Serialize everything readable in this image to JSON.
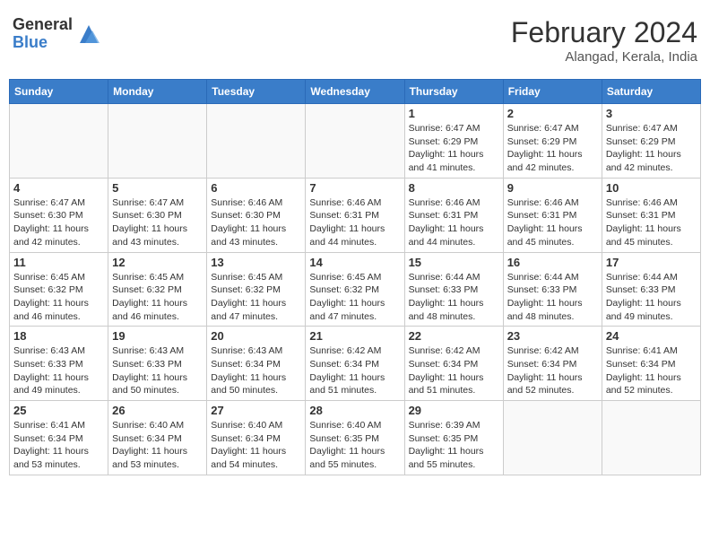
{
  "header": {
    "logo_general": "General",
    "logo_blue": "Blue",
    "month_year": "February 2024",
    "location": "Alangad, Kerala, India"
  },
  "days_of_week": [
    "Sunday",
    "Monday",
    "Tuesday",
    "Wednesday",
    "Thursday",
    "Friday",
    "Saturday"
  ],
  "weeks": [
    [
      {
        "day": "",
        "info": ""
      },
      {
        "day": "",
        "info": ""
      },
      {
        "day": "",
        "info": ""
      },
      {
        "day": "",
        "info": ""
      },
      {
        "day": "1",
        "info": "Sunrise: 6:47 AM\nSunset: 6:29 PM\nDaylight: 11 hours and 41 minutes."
      },
      {
        "day": "2",
        "info": "Sunrise: 6:47 AM\nSunset: 6:29 PM\nDaylight: 11 hours and 42 minutes."
      },
      {
        "day": "3",
        "info": "Sunrise: 6:47 AM\nSunset: 6:29 PM\nDaylight: 11 hours and 42 minutes."
      }
    ],
    [
      {
        "day": "4",
        "info": "Sunrise: 6:47 AM\nSunset: 6:30 PM\nDaylight: 11 hours and 42 minutes."
      },
      {
        "day": "5",
        "info": "Sunrise: 6:47 AM\nSunset: 6:30 PM\nDaylight: 11 hours and 43 minutes."
      },
      {
        "day": "6",
        "info": "Sunrise: 6:46 AM\nSunset: 6:30 PM\nDaylight: 11 hours and 43 minutes."
      },
      {
        "day": "7",
        "info": "Sunrise: 6:46 AM\nSunset: 6:31 PM\nDaylight: 11 hours and 44 minutes."
      },
      {
        "day": "8",
        "info": "Sunrise: 6:46 AM\nSunset: 6:31 PM\nDaylight: 11 hours and 44 minutes."
      },
      {
        "day": "9",
        "info": "Sunrise: 6:46 AM\nSunset: 6:31 PM\nDaylight: 11 hours and 45 minutes."
      },
      {
        "day": "10",
        "info": "Sunrise: 6:46 AM\nSunset: 6:31 PM\nDaylight: 11 hours and 45 minutes."
      }
    ],
    [
      {
        "day": "11",
        "info": "Sunrise: 6:45 AM\nSunset: 6:32 PM\nDaylight: 11 hours and 46 minutes."
      },
      {
        "day": "12",
        "info": "Sunrise: 6:45 AM\nSunset: 6:32 PM\nDaylight: 11 hours and 46 minutes."
      },
      {
        "day": "13",
        "info": "Sunrise: 6:45 AM\nSunset: 6:32 PM\nDaylight: 11 hours and 47 minutes."
      },
      {
        "day": "14",
        "info": "Sunrise: 6:45 AM\nSunset: 6:32 PM\nDaylight: 11 hours and 47 minutes."
      },
      {
        "day": "15",
        "info": "Sunrise: 6:44 AM\nSunset: 6:33 PM\nDaylight: 11 hours and 48 minutes."
      },
      {
        "day": "16",
        "info": "Sunrise: 6:44 AM\nSunset: 6:33 PM\nDaylight: 11 hours and 48 minutes."
      },
      {
        "day": "17",
        "info": "Sunrise: 6:44 AM\nSunset: 6:33 PM\nDaylight: 11 hours and 49 minutes."
      }
    ],
    [
      {
        "day": "18",
        "info": "Sunrise: 6:43 AM\nSunset: 6:33 PM\nDaylight: 11 hours and 49 minutes."
      },
      {
        "day": "19",
        "info": "Sunrise: 6:43 AM\nSunset: 6:33 PM\nDaylight: 11 hours and 50 minutes."
      },
      {
        "day": "20",
        "info": "Sunrise: 6:43 AM\nSunset: 6:34 PM\nDaylight: 11 hours and 50 minutes."
      },
      {
        "day": "21",
        "info": "Sunrise: 6:42 AM\nSunset: 6:34 PM\nDaylight: 11 hours and 51 minutes."
      },
      {
        "day": "22",
        "info": "Sunrise: 6:42 AM\nSunset: 6:34 PM\nDaylight: 11 hours and 51 minutes."
      },
      {
        "day": "23",
        "info": "Sunrise: 6:42 AM\nSunset: 6:34 PM\nDaylight: 11 hours and 52 minutes."
      },
      {
        "day": "24",
        "info": "Sunrise: 6:41 AM\nSunset: 6:34 PM\nDaylight: 11 hours and 52 minutes."
      }
    ],
    [
      {
        "day": "25",
        "info": "Sunrise: 6:41 AM\nSunset: 6:34 PM\nDaylight: 11 hours and 53 minutes."
      },
      {
        "day": "26",
        "info": "Sunrise: 6:40 AM\nSunset: 6:34 PM\nDaylight: 11 hours and 53 minutes."
      },
      {
        "day": "27",
        "info": "Sunrise: 6:40 AM\nSunset: 6:34 PM\nDaylight: 11 hours and 54 minutes."
      },
      {
        "day": "28",
        "info": "Sunrise: 6:40 AM\nSunset: 6:35 PM\nDaylight: 11 hours and 55 minutes."
      },
      {
        "day": "29",
        "info": "Sunrise: 6:39 AM\nSunset: 6:35 PM\nDaylight: 11 hours and 55 minutes."
      },
      {
        "day": "",
        "info": ""
      },
      {
        "day": "",
        "info": ""
      }
    ]
  ]
}
